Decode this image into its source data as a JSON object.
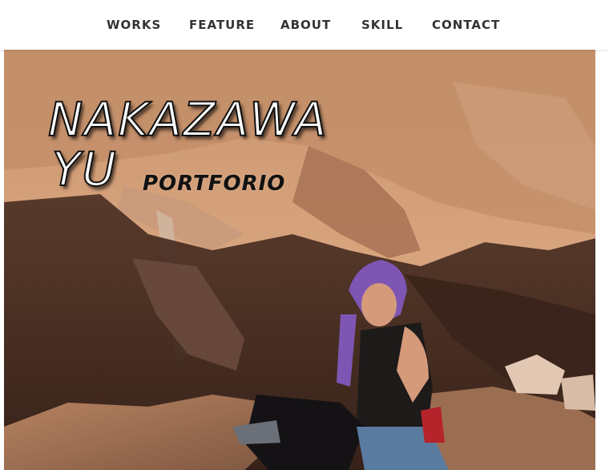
{
  "nav": {
    "items": [
      {
        "label": "WORKS"
      },
      {
        "label": "FEATURE"
      },
      {
        "label": "ABOUT"
      },
      {
        "label": "SKILL"
      },
      {
        "label": "CONTACT"
      }
    ]
  },
  "hero": {
    "name_line1": "NAKAZAWA",
    "name_line2": "YU",
    "subtitle": "PORTFORIO"
  },
  "colors": {
    "nav_background": "#ffffff",
    "nav_text": "#333333",
    "title_fill": "#ffffff",
    "title_outline": "#111111",
    "subtitle": "#111111"
  }
}
